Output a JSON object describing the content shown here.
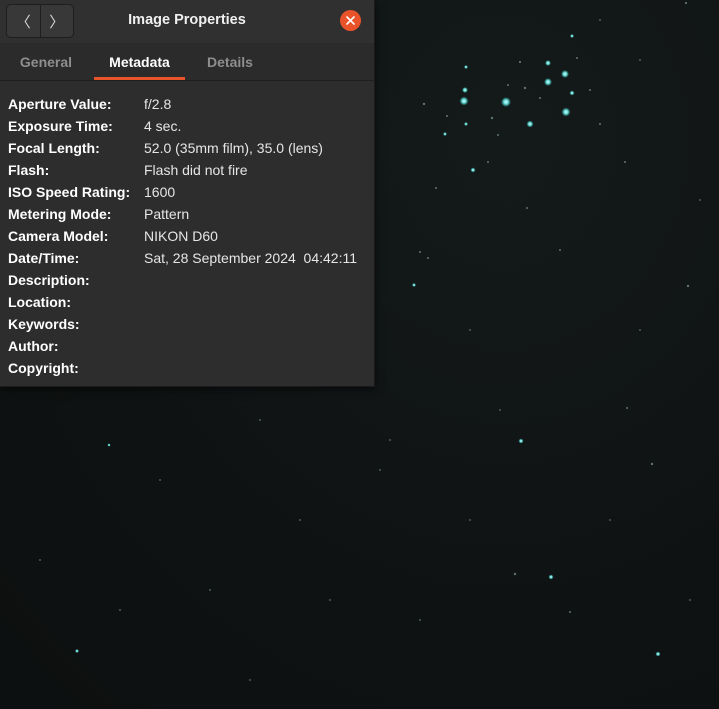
{
  "dialog": {
    "title": "Image Properties",
    "nav": {
      "back_glyph": "〈",
      "forward_glyph": "〉"
    },
    "close_color": "#e9532a",
    "tabs": [
      {
        "label": "General",
        "active": false
      },
      {
        "label": "Metadata",
        "active": true
      },
      {
        "label": "Details",
        "active": false
      }
    ],
    "properties": [
      {
        "label": "Aperture Value:",
        "value": "f/2.8"
      },
      {
        "label": "Exposure Time:",
        "value": "4 sec."
      },
      {
        "label": "Focal Length:",
        "value": "52.0 (35mm film), 35.0 (lens)"
      },
      {
        "label": "Flash:",
        "value": "Flash did not fire"
      },
      {
        "label": "ISO Speed Rating:",
        "value": "1600"
      },
      {
        "label": "Metering Mode:",
        "value": "Pattern"
      },
      {
        "label": "Camera Model:",
        "value": "NIKON D60"
      },
      {
        "label": "Date/Time:",
        "value": "Sat, 28 September 2024  04:42:11"
      },
      {
        "label": "Description:",
        "value": ""
      },
      {
        "label": "Location:",
        "value": ""
      },
      {
        "label": "Keywords:",
        "value": ""
      },
      {
        "label": "Author:",
        "value": ""
      },
      {
        "label": "Copyright:",
        "value": ""
      }
    ]
  },
  "viewer": {
    "accent_star_color": "#7ff5f0",
    "background_color": "#101313"
  }
}
